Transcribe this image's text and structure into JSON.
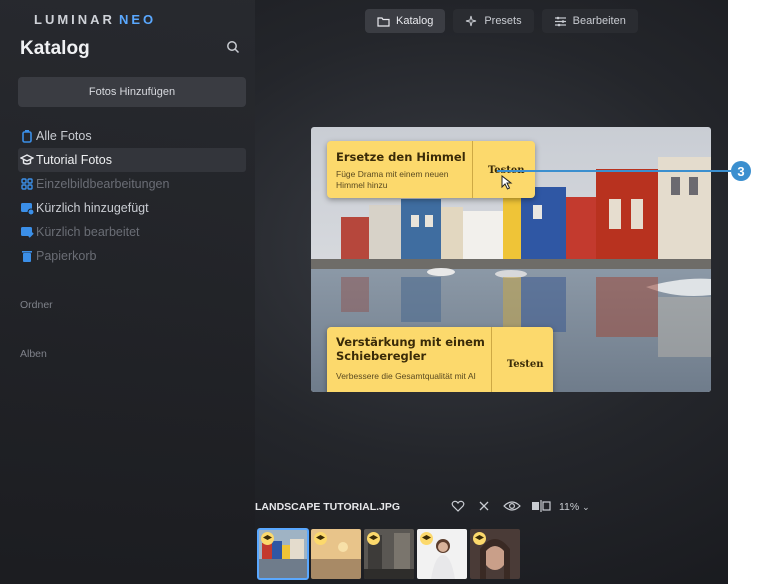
{
  "app": {
    "logo_main": "LUMINAR",
    "logo_accent": "NEO"
  },
  "topbar": {
    "tabs": [
      {
        "label": "Katalog",
        "icon": "folder-icon",
        "active": true
      },
      {
        "label": "Presets",
        "icon": "sparkle-icon",
        "active": false
      },
      {
        "label": "Bearbeiten",
        "icon": "sliders-icon",
        "active": false
      }
    ]
  },
  "sidebar": {
    "title": "Katalog",
    "add_button": "Fotos Hinzufügen",
    "items": [
      {
        "label": "Alle Fotos",
        "icon": "photos-icon",
        "icon_color": "#3b8fe8"
      },
      {
        "label": "Tutorial Fotos",
        "icon": "graduation-cap-icon",
        "icon_color": "#e9eaee"
      },
      {
        "label": "Einzelbildbearbeitungen",
        "icon": "grid-icon",
        "icon_color": "#3b8fe8"
      },
      {
        "label": "Kürzlich hinzugefügt",
        "icon": "image-add-icon",
        "icon_color": "#3b8fe8"
      },
      {
        "label": "Kürzlich bearbeitet",
        "icon": "image-edit-icon",
        "icon_color": "#3b8fe8"
      },
      {
        "label": "Papierkorb",
        "icon": "trash-icon",
        "icon_color": "#3b8fe8"
      }
    ],
    "section_folders": "Ordner",
    "section_albums": "Alben"
  },
  "tutorial_cards": [
    {
      "title": "Ersetze den Himmel",
      "description": "Füge Drama mit einem neuen Himmel hinzu",
      "button": "Testen"
    },
    {
      "title": "Verstärkung mit einem Schieberegler",
      "description": "Verbessere die Gesamtqualität mit AI",
      "button": "Testen"
    }
  ],
  "callout": {
    "number": "3"
  },
  "bottom_bar": {
    "filename": "LANDSCAPE TUTORIAL.JPG",
    "zoom": "11%"
  },
  "filmstrip": [
    {
      "subject": "colorful houses by canal",
      "active": true
    },
    {
      "subject": "beach sunset",
      "active": false
    },
    {
      "subject": "city street",
      "active": false
    },
    {
      "subject": "portrait woman in white",
      "active": false
    },
    {
      "subject": "portrait woman close-up",
      "active": false
    }
  ],
  "colors": {
    "accent": "#3b8fcf",
    "card": "#fcd96c",
    "neo": "#5aa8ff"
  }
}
